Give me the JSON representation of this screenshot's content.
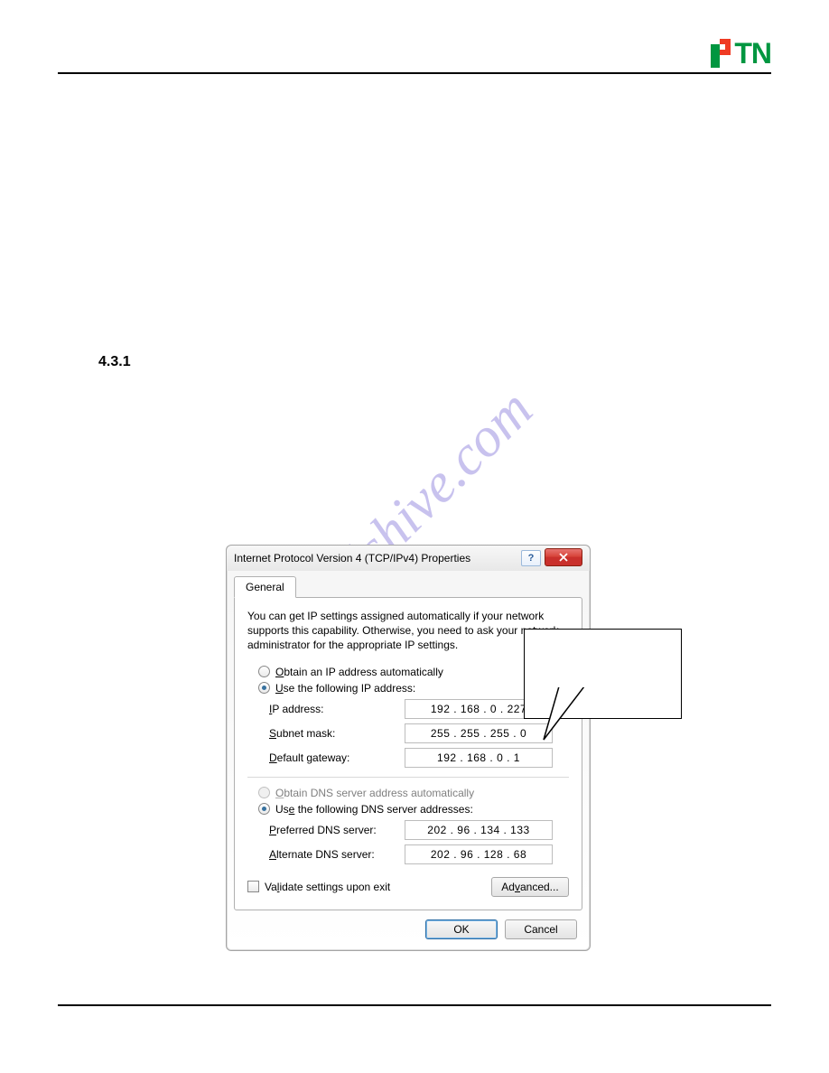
{
  "logo": {
    "brand": "PTN"
  },
  "section": {
    "number": "4.3.1"
  },
  "watermark": {
    "text": "manualshive.com"
  },
  "dialog": {
    "title": "Internet Protocol Version 4 (TCP/IPv4) Properties",
    "help_symbol": "?",
    "tab": {
      "general": "General"
    },
    "description": "You can get IP settings assigned automatically if your network supports this capability. Otherwise, you need to ask your network administrator for the appropriate IP settings.",
    "ip": {
      "auto_label_pre": "O",
      "auto_label_rest": "btain an IP address automatically",
      "manual_label_pre": "U",
      "manual_label_rest": "se the following IP address:",
      "addr_label_pre": "I",
      "addr_label_rest": "P address:",
      "mask_label_pre": "S",
      "mask_label_rest": "ubnet mask:",
      "gw_label_pre": "D",
      "gw_label_rest": "efault gateway:",
      "addr_value": "192 . 168 .   0   . 227",
      "mask_value": "255 . 255 . 255 .   0",
      "gw_value": "192 . 168 .   0   .   1"
    },
    "dns": {
      "auto_label_pre": "O",
      "auto_label_rest": "btain DNS server address automatically",
      "manual_label_pre": "Us",
      "manual_label_u": "e",
      "manual_label_rest": " the following DNS server addresses:",
      "pref_label_pre": "P",
      "pref_label_rest": "referred DNS server:",
      "alt_label_pre": "A",
      "alt_label_rest": "lternate DNS server:",
      "pref_value": "202 .  96  . 134 . 133",
      "alt_value": "202 .  96  . 128 .  68"
    },
    "validate": {
      "label_pre": "Va",
      "label_u": "l",
      "label_rest": "idate settings upon exit"
    },
    "advanced": {
      "label_pre": "Ad",
      "label_u": "v",
      "label_rest": "anced..."
    },
    "buttons": {
      "ok": "OK",
      "cancel": "Cancel"
    }
  }
}
